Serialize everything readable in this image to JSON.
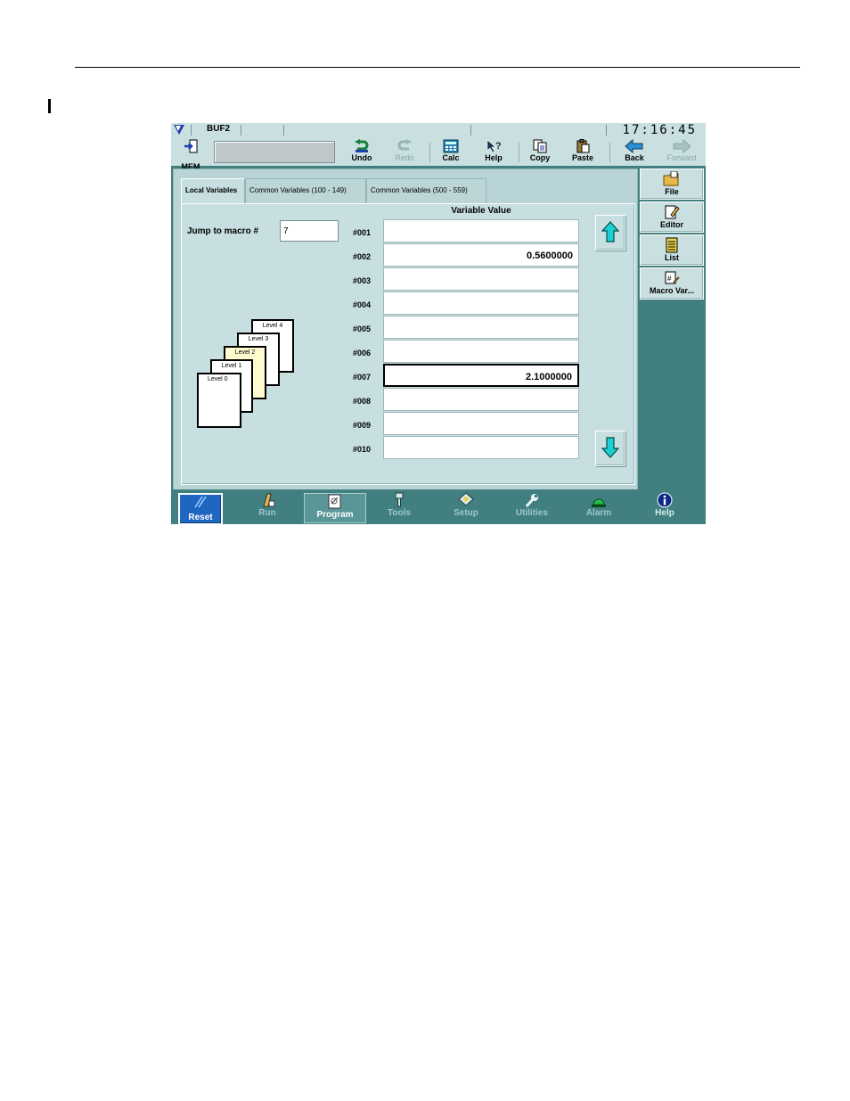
{
  "titlebar": {
    "buffer": "BUF2",
    "clock": "17:16:45"
  },
  "toolbar": {
    "mem_label": "MEM",
    "buttons": [
      {
        "label": "Undo",
        "icon": "undo-icon",
        "enabled": true
      },
      {
        "label": "Redo",
        "icon": "redo-icon",
        "enabled": false
      },
      {
        "label": "Calc",
        "icon": "calculator-icon",
        "enabled": true
      },
      {
        "label": "Help",
        "icon": "help-icon",
        "enabled": true
      },
      {
        "label": "Copy",
        "icon": "copy-icon",
        "enabled": true
      },
      {
        "label": "Paste",
        "icon": "paste-icon",
        "enabled": true
      },
      {
        "label": "Back",
        "icon": "back-arrow-icon",
        "enabled": true
      },
      {
        "label": "Forward",
        "icon": "forward-arrow-icon",
        "enabled": false
      }
    ]
  },
  "tabs": [
    {
      "label": "Local Variables",
      "active": true
    },
    {
      "label": "Common Variables (100 - 149)",
      "active": false
    },
    {
      "label": "Common Variables (500 - 559)",
      "active": false
    }
  ],
  "jump": {
    "label": "Jump to macro #",
    "value": "7"
  },
  "variables": {
    "header": "Variable Value",
    "rows": [
      {
        "name": "#001",
        "value": ""
      },
      {
        "name": "#002",
        "value": "0.5600000"
      },
      {
        "name": "#003",
        "value": ""
      },
      {
        "name": "#004",
        "value": ""
      },
      {
        "name": "#005",
        "value": ""
      },
      {
        "name": "#006",
        "value": ""
      },
      {
        "name": "#007",
        "value": "2.1000000",
        "selected": true
      },
      {
        "name": "#008",
        "value": ""
      },
      {
        "name": "#009",
        "value": ""
      },
      {
        "name": "#010",
        "value": ""
      }
    ]
  },
  "levels": [
    "Level 4",
    "Level 3",
    "Level 2",
    "Level 1",
    "Level 0"
  ],
  "right_nav": [
    {
      "label": "File",
      "icon": "folder-icon"
    },
    {
      "label": "Editor",
      "icon": "editor-icon"
    },
    {
      "label": "List",
      "icon": "list-icon"
    },
    {
      "label": "Macro Var...",
      "icon": "macro-variable-icon",
      "active": true
    }
  ],
  "bottom_nav": {
    "reset": "Reset",
    "items": [
      {
        "label": "Run",
        "icon": "run-icon"
      },
      {
        "label": "Program",
        "icon": "program-icon",
        "active": true
      },
      {
        "label": "Tools",
        "icon": "tools-icon"
      },
      {
        "label": "Setup",
        "icon": "setup-icon"
      },
      {
        "label": "Utilities",
        "icon": "wrench-icon"
      },
      {
        "label": "Alarm",
        "icon": "alarm-light-icon"
      },
      {
        "label": "Help",
        "icon": "info-icon"
      }
    ]
  }
}
